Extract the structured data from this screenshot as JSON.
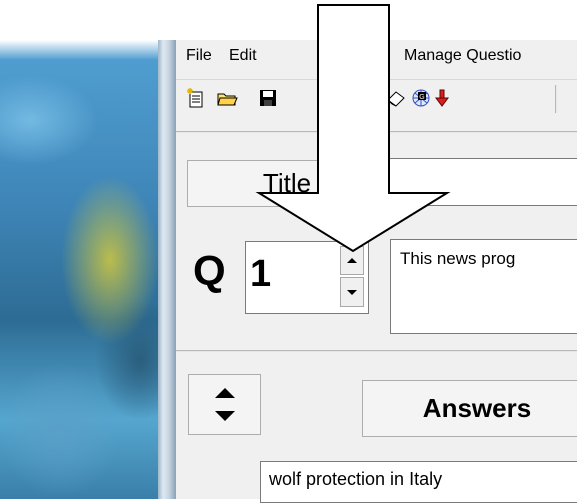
{
  "menu": {
    "items": [
      "File",
      "Edit",
      "Manage Questio"
    ]
  },
  "toolbar": {
    "icons": [
      "new-file-icon",
      "open-folder-icon",
      "save-disk-icon",
      "eraser-icon",
      "network-icon",
      "down-arrow-icon"
    ]
  },
  "title": {
    "label": "Title",
    "value": ""
  },
  "question": {
    "prefix": "Q",
    "number": "1",
    "text": "This news prog"
  },
  "answers": {
    "button_label": "Answers",
    "first_answer": "wolf protection in Italy"
  },
  "colors": {
    "window_bg": "#f0f0f0",
    "arrow_fill": "#ffffff",
    "arrow_stroke": "#000000",
    "down_icon_red": "#d42020"
  }
}
